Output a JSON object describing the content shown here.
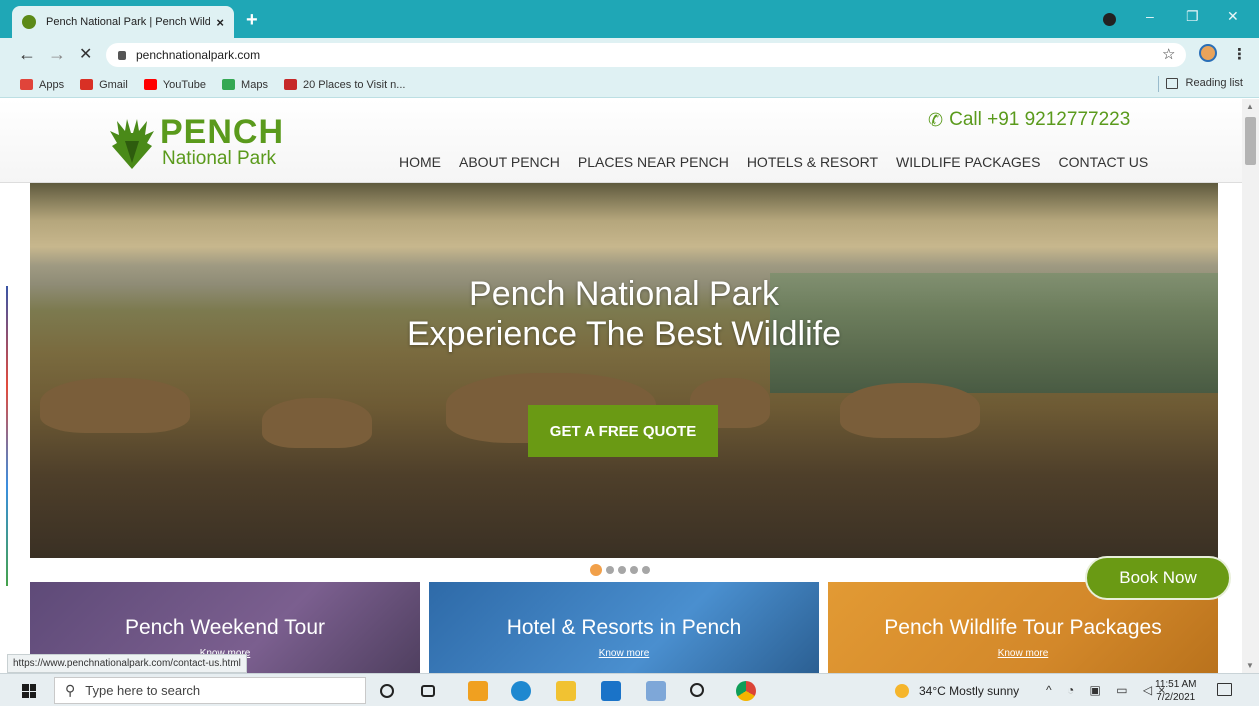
{
  "browser": {
    "tab_title": "Pench National Park | Pench Wild",
    "tab_close": "×",
    "new_tab": "+",
    "url": "penchnationalpark.com",
    "back": "←",
    "forward": "→",
    "stop": "✕",
    "star": "☆",
    "menu": "⋮",
    "minimize": "–",
    "maximize": "❐",
    "close": "✕",
    "bookmarks": [
      {
        "label": "Apps",
        "color": "#e0443a"
      },
      {
        "label": "Gmail",
        "color": "#d93025"
      },
      {
        "label": "YouTube",
        "color": "#ff0000"
      },
      {
        "label": "Maps",
        "color": "#34a853"
      },
      {
        "label": "20 Places to Visit n...",
        "color": "#c62828"
      }
    ],
    "reading_list": "Reading list",
    "status_url": "https://www.penchnationalpark.com/contact-us.html"
  },
  "site": {
    "logo_main": "PENCH",
    "logo_sub": "National Park",
    "phone_icon": "phone-icon",
    "call_text": "Call +91 9212777223",
    "nav": [
      "HOME",
      "ABOUT PENCH",
      "PLACES NEAR PENCH",
      "HOTELS & RESORT",
      "WILDLIFE PACKAGES",
      "CONTACT US"
    ],
    "hero_line1": "Pench National Park",
    "hero_line2": "Experience The Best Wildlife",
    "cta": "GET A FREE QUOTE",
    "slides": 5,
    "active_slide": 1,
    "book_now": "Book Now",
    "cards": [
      {
        "title": "Pench Weekend Tour",
        "link": "Know more",
        "color": "#6b4f86"
      },
      {
        "title": "Hotel & Resorts in Pench",
        "link": "Know more",
        "color": "#3f7ebf"
      },
      {
        "title": "Pench Wildlife Tour Packages",
        "link": "Know more",
        "color": "#d8902d"
      }
    ],
    "brand_color": "#6a9a14"
  },
  "taskbar": {
    "search_placeholder": "Type here to search",
    "weather": "34°C  Mostly sunny",
    "time": "11:51 AM",
    "date": "7/2/2021"
  }
}
